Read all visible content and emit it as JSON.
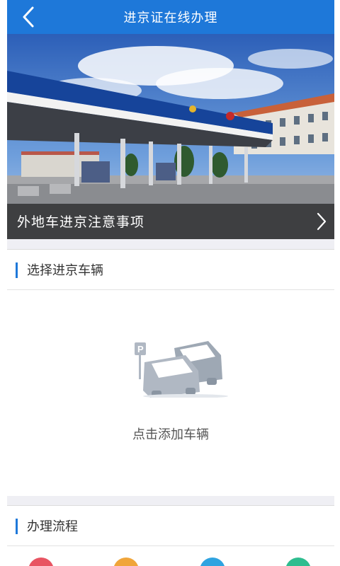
{
  "header": {
    "title": "进京证在线办理"
  },
  "banner": {
    "caption": "外地车进京注意事项"
  },
  "vehicle_section": {
    "title": "选择进京车辆",
    "add_label": "点击添加车辆"
  },
  "process_section": {
    "title": "办理流程"
  },
  "process_icons": [
    {
      "name": "apply-icon",
      "color": "#e85462"
    },
    {
      "name": "form-icon",
      "color": "#f0a53a"
    },
    {
      "name": "review-icon",
      "color": "#2fa3e0"
    },
    {
      "name": "complete-icon",
      "color": "#2ebd8f"
    }
  ],
  "colors": {
    "accent": "#1e78d9",
    "background": "#efeff4"
  }
}
